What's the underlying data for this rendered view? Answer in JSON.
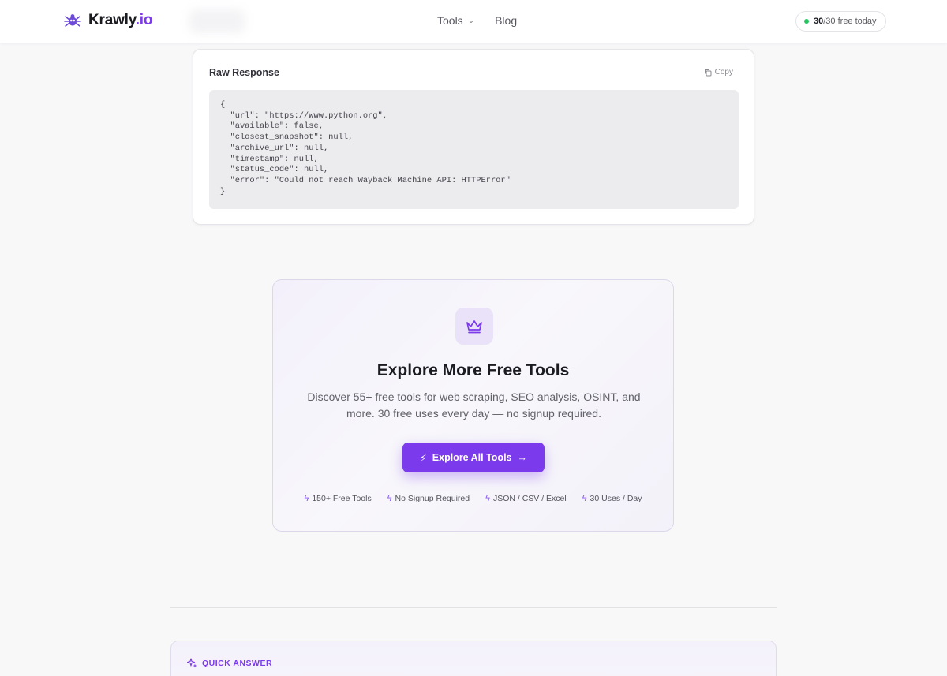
{
  "header": {
    "logo_name": "Krawly",
    "logo_suffix": ".io",
    "nav": [
      {
        "label": "Tools",
        "has_dropdown": true
      },
      {
        "label": "Blog",
        "has_dropdown": false
      }
    ],
    "usage": {
      "used": "30",
      "rest": "/30 free today"
    }
  },
  "raw_response": {
    "title": "Raw Response",
    "copy_label": "Copy",
    "code": "{\n  \"url\": \"https://www.python.org\",\n  \"available\": false,\n  \"closest_snapshot\": null,\n  \"archive_url\": null,\n  \"timestamp\": null,\n  \"status_code\": null,\n  \"error\": \"Could not reach Wayback Machine API: HTTPError\"\n}"
  },
  "explore": {
    "title": "Explore More Free Tools",
    "description": "Discover 55+ free tools for web scraping, SEO analysis, OSINT, and more. 30 free uses every day — no signup required.",
    "button_label": "Explore All Tools",
    "features": [
      "150+ Free Tools",
      "No Signup Required",
      "JSON / CSV / Excel",
      "30 Uses / Day"
    ]
  },
  "quick_answer": {
    "label": "QUICK ANSWER"
  },
  "colors": {
    "accent": "#7c3aed",
    "status_ok": "#22c55e"
  }
}
